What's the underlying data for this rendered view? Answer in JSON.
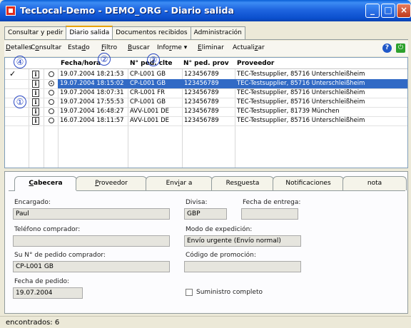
{
  "window": {
    "title": "TecLocal-Demo - DEMO_ORG - Diario salida"
  },
  "main_tabs": [
    {
      "label": "Consultar y pedir"
    },
    {
      "label": "Diario salida",
      "active": true
    },
    {
      "label": "Documentos recibidos"
    },
    {
      "label": "Administración"
    }
  ],
  "toolbar": {
    "items": [
      {
        "pre": "",
        "u": "D",
        "post": "etalles"
      },
      {
        "pre": "C",
        "u": "o",
        "post": "nsultar"
      },
      {
        "pre": "Esta",
        "u": "d",
        "post": "o"
      },
      {
        "pre": "",
        "u": "F",
        "post": "iltro"
      },
      {
        "pre": "",
        "u": "B",
        "post": "uscar"
      },
      {
        "pre": "Info",
        "u": "r",
        "post": "me ▾"
      },
      {
        "pre": "",
        "u": "E",
        "post": "liminar"
      },
      {
        "pre": "Actuali",
        "u": "z",
        "post": "ar"
      }
    ],
    "help_icon": "help-icon",
    "exit_icon": "power-icon"
  },
  "table": {
    "columns": [
      "Fecha/hora",
      "N° ped. clte",
      "N° ped. prov",
      "Proveedor"
    ],
    "rows": [
      {
        "checked": true,
        "radio": false,
        "selected": false,
        "fecha": "19.07.2004 18:21:53",
        "clte": "CP-L001 GB",
        "prov": "123456789",
        "proveedor": "TEC-Testsupplier, 85716 Unterschleißheim"
      },
      {
        "checked": false,
        "radio": true,
        "selected": true,
        "fecha": "19.07.2004 18:15:02",
        "clte": "CP-L001 GB",
        "prov": "123456789",
        "proveedor": "TEC-Testsupplier, 85716 Unterschleißheim"
      },
      {
        "checked": false,
        "radio": false,
        "selected": false,
        "fecha": "19.07.2004 18:07:31",
        "clte": "CR-L001 FR",
        "prov": "123456789",
        "proveedor": "TEC-Testsupplier, 85716 Unterschleißheim"
      },
      {
        "checked": false,
        "radio": false,
        "selected": false,
        "fecha": "19.07.2004 17:55:53",
        "clte": "CP-L001 GB",
        "prov": "123456789",
        "proveedor": "TEC-Testsupplier, 85716 Unterschleißheim"
      },
      {
        "checked": false,
        "radio": false,
        "selected": false,
        "fecha": "19.07.2004 16:48:27",
        "clte": "AVV-L001 DE",
        "prov": "123456789",
        "proveedor": "TEC-Testsupplier, 81739 München"
      },
      {
        "checked": false,
        "radio": false,
        "selected": false,
        "fecha": "16.07.2004 18:11:57",
        "clte": "AVV-L001 DE",
        "prov": "123456789",
        "proveedor": "TEC-Testsupplier, 85716 Unterschleißheim"
      }
    ],
    "check_symbol": "✓",
    "info_symbol": "i"
  },
  "callouts": [
    "④",
    "②",
    "③",
    "①"
  ],
  "detail_tabs": [
    {
      "pre": "",
      "u": "C",
      "post": "abecera",
      "active": true
    },
    {
      "pre": "",
      "u": "P",
      "post": "roveedor"
    },
    {
      "pre": "Env",
      "u": "i",
      "post": "ar a"
    },
    {
      "pre": "Res",
      "u": "p",
      "post": "uesta"
    },
    {
      "pre": "",
      "u": "",
      "post": "Notificaciones"
    },
    {
      "pre": "",
      "u": "",
      "post": "nota"
    }
  ],
  "form": {
    "encargado_label": "Encargado:",
    "encargado_value": "Paul",
    "divisa_label": "Divisa:",
    "divisa_value": "GBP",
    "fecha_entrega_label": "Fecha de entrega:",
    "fecha_entrega_value": "",
    "telefono_label": "Teléfono comprador:",
    "telefono_value": "",
    "modo_label": "Modo de expedición:",
    "modo_value": "Envío urgente (Envío normal)",
    "pedido_label": "Su N° de pedido comprador:",
    "pedido_value": "CP-L001 GB",
    "promo_label": "Código de promoción:",
    "promo_value": "",
    "fecha_pedido_label": "Fecha de pedido:",
    "fecha_pedido_value": "19.07.2004",
    "suministro_label": "Suministro completo",
    "suministro_checked": false
  },
  "status": {
    "text": "encontrados: 6"
  }
}
